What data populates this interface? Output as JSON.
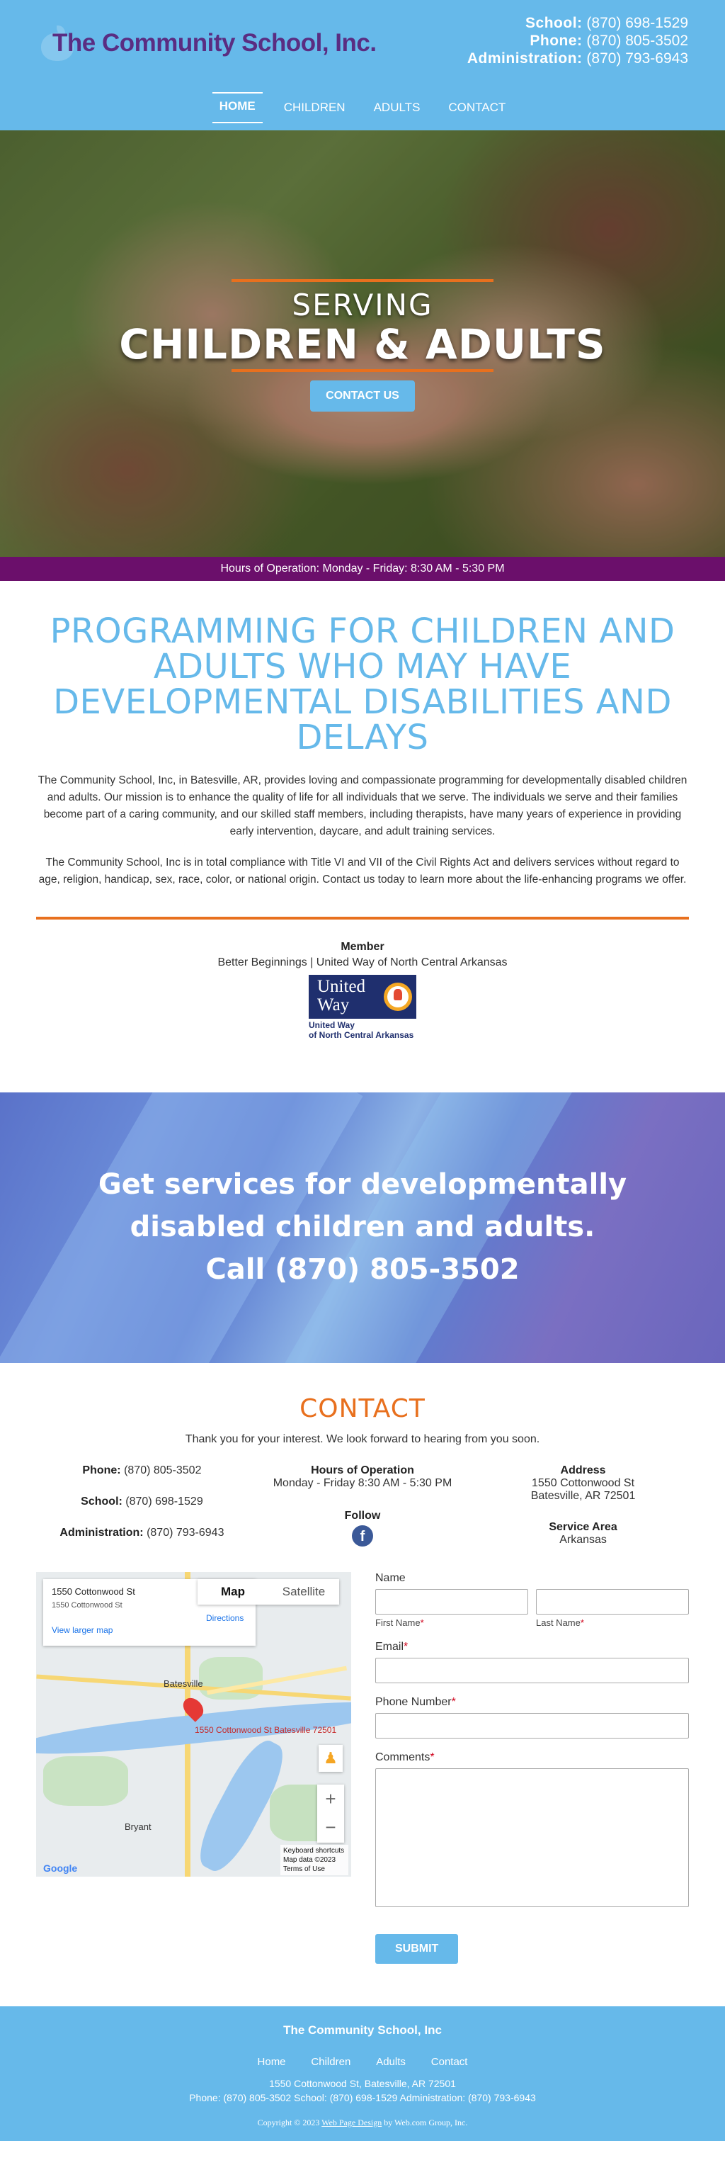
{
  "header": {
    "logo_text": "The Community School, Inc.",
    "contacts": [
      {
        "label": "School:",
        "value": "(870) 698-1529"
      },
      {
        "label": "Phone:",
        "value": "(870) 805-3502"
      },
      {
        "label": "Administration:",
        "value": "(870) 793-6943"
      }
    ]
  },
  "nav": [
    "HOME",
    "CHILDREN",
    "ADULTS",
    "CONTACT"
  ],
  "hero": {
    "subtitle": "SERVING",
    "title": "CHILDREN & ADULTS",
    "button": "CONTACT US"
  },
  "hours_bar": "Hours of Operation: Monday - Friday: 8:30 AM - 5:30 PM",
  "intro": {
    "heading": "PROGRAMMING FOR CHILDREN AND ADULTS WHO MAY HAVE DEVELOPMENTAL DISABILITIES AND DELAYS",
    "p1": "The Community School, Inc, in Batesville, AR, provides loving and compassionate programming for developmentally disabled children and adults. Our mission is to enhance the quality of life for all individuals that we serve. The individuals we serve and their families become part of a caring community, and our skilled staff members, including therapists, have many years of experience in providing early intervention, daycare, and adult training services.",
    "p2": "The Community School, Inc is in total compliance with Title VI and VII of the Civil Rights Act and delivers services without regard to age, religion, handicap, sex, race, color, or national origin. Contact us today to learn more about the life-enhancing programs we offer."
  },
  "member": {
    "title": "Member",
    "text": "Better Beginnings | United Way of North Central Arkansas",
    "logo_line1": "United",
    "logo_line2": "Way",
    "logo_caption1": "United Way",
    "logo_caption2": "of North Central Arkansas"
  },
  "banner": {
    "line1": "Get services for developmentally",
    "line2": "disabled children and adults.",
    "line3": "Call (870) 805-3502"
  },
  "contact": {
    "heading": "CONTACT",
    "thanks": "Thank you for your interest. We look forward to hearing from you soon.",
    "phones": [
      {
        "label": "Phone:",
        "value": "(870) 805-3502"
      },
      {
        "label": "School:",
        "value": "(870) 698-1529"
      },
      {
        "label": "Administration:",
        "value": "(870) 793-6943"
      }
    ],
    "hours_title": "Hours of Operation",
    "hours_text": "Monday - Friday 8:30 AM - 5:30 PM",
    "follow": "Follow",
    "address_title": "Address",
    "address_line1": "1550 Cottonwood St",
    "address_line2": "Batesville, AR 72501",
    "service_title": "Service Area",
    "service_text": "Arkansas"
  },
  "map": {
    "card_title": "1550 Cottonwood St",
    "card_addr": "1550 Cottonwood St",
    "directions": "Directions",
    "larger": "View larger map",
    "tab_map": "Map",
    "tab_satellite": "Satellite",
    "town1": "Batesville",
    "town2": "Bryant",
    "pin_label": "1550 Cottonwood St Batesville 72501",
    "terms1": "Keyboard shortcuts",
    "terms2": "Map data ©2023",
    "terms3": "Terms of Use",
    "google": "Google"
  },
  "form": {
    "name_label": "Name",
    "first_label": "First Name",
    "last_label": "Last Name",
    "email_label": "Email",
    "phone_label": "Phone Number",
    "comments_label": "Comments",
    "submit": "SUBMIT",
    "required_mark": "*"
  },
  "footer": {
    "title": "The Community School, Inc",
    "nav": [
      "Home",
      "Children",
      "Adults",
      "Contact"
    ],
    "address": "1550 Cottonwood St, Batesville, AR 72501",
    "phones": "Phone: (870) 805-3502 School: (870) 698-1529 Administration: (870) 793-6943",
    "copy_pre": "Copyright © 2023",
    "copy_link": "Web Page Design",
    "copy_post": "by Web.com Group, Inc."
  },
  "colors": {
    "primary_blue": "#66b9ea",
    "orange": "#e8701e",
    "purple_bar": "#6b0f6b",
    "logo_purple": "#5a2d82"
  }
}
